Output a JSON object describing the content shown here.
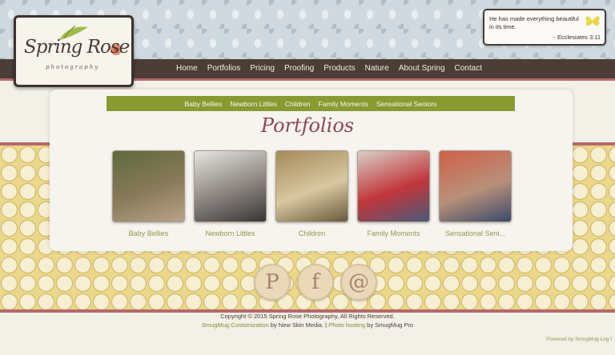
{
  "brand": {
    "logo_script": "Spring Rose",
    "logo_sub": "photography"
  },
  "verse": {
    "text": "He has made everything beautiful in its time.",
    "ref": "- Ecclesiates 3:11"
  },
  "nav": [
    "Home",
    "Portfolios",
    "Pricing",
    "Proofing",
    "Products",
    "Nature",
    "About Spring",
    "Contact"
  ],
  "subnav": [
    "Baby Bellies",
    "Newborn Littles",
    "Children",
    "Family Moments",
    "Sensational Seniors"
  ],
  "page_title": "Portfolios",
  "gallery": [
    {
      "label": "Baby Bellies",
      "colors": [
        "#5e6a3c",
        "#8a7a5a",
        "#b8a48a"
      ]
    },
    {
      "label": "Newborn Littles",
      "colors": [
        "#e8e4e0",
        "#8a8480",
        "#3a3634"
      ]
    },
    {
      "label": "Children",
      "colors": [
        "#a48a5a",
        "#d8c7a0",
        "#6a5a3c"
      ]
    },
    {
      "label": "Family Moments",
      "colors": [
        "#d8d0c8",
        "#c2363a",
        "#4a5a7a"
      ]
    },
    {
      "label": "Sensational Seni...",
      "colors": [
        "#d06048",
        "#b8907a",
        "#3a4a6a"
      ]
    }
  ],
  "social": [
    {
      "name": "pinterest-icon",
      "glyph": "P"
    },
    {
      "name": "facebook-icon",
      "glyph": "f"
    },
    {
      "name": "email-icon",
      "glyph": "@"
    }
  ],
  "footer": {
    "copyright": "Copyright © 2015 Spring Rose Photography, All Rights Reserved.",
    "custom_link": "SmugMug Customization",
    "by_new_skin": " by New Skin Media. | ",
    "hosting_link": "Photo hosting",
    "by_smugmug": " by SmugMug Pro"
  },
  "powered": "Powered by SmugMug   Log I",
  "colors": {
    "nav": "#4b3d37",
    "accent": "#b56a6a",
    "subnav": "#8a9a32",
    "title": "#8f4656"
  }
}
